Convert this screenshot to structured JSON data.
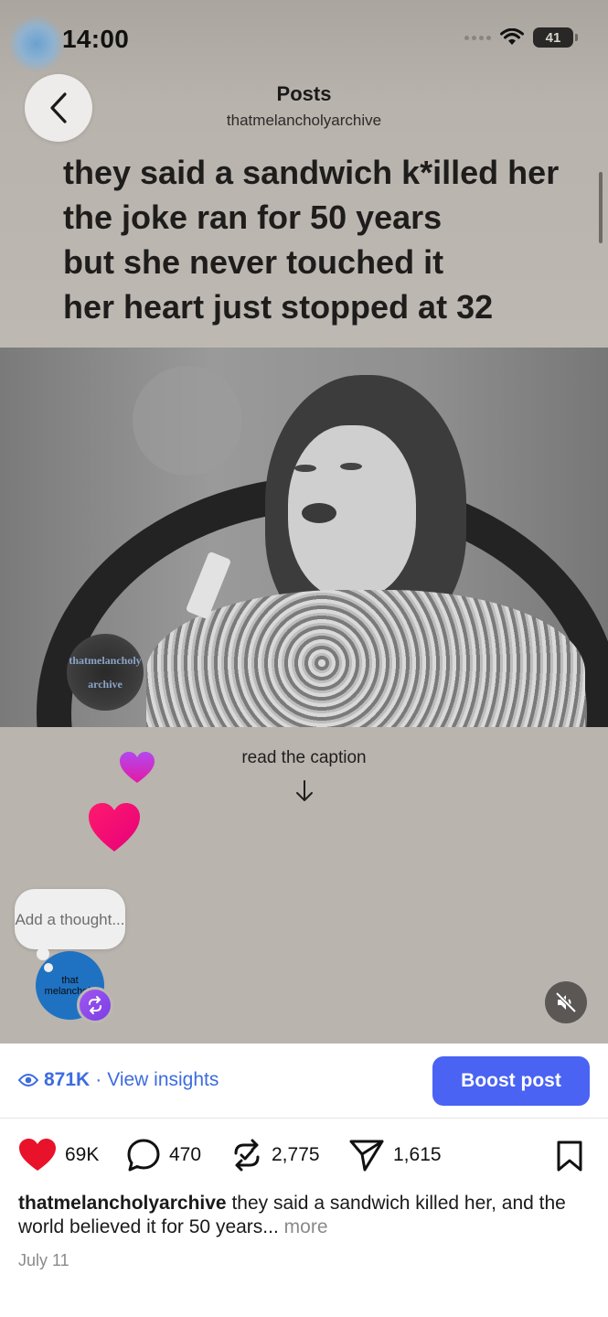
{
  "status_bar": {
    "time": "14:00",
    "battery": "41"
  },
  "header": {
    "title": "Posts",
    "username": "thatmelancholyarchive"
  },
  "post_overlay_lines": [
    "they said a sandwich k*illed her",
    "the joke ran for 50 years",
    "but she never touched it",
    "her heart just stopped at 32"
  ],
  "video_watermark": {
    "line1": "thatmelancholy",
    "line2": "archive"
  },
  "caption_hint": "read the caption",
  "thought_bubble": {
    "text": "Add a thought..."
  },
  "avatar_text": {
    "line1": "that",
    "line2": "melancholy"
  },
  "insights": {
    "views": "871K",
    "separator": "·",
    "link_label": "View insights"
  },
  "boost_label": "Boost post",
  "actions": {
    "likes": "69K",
    "comments": "470",
    "reposts": "2,775",
    "shares": "1,615"
  },
  "caption": {
    "username": "thatmelancholyarchive",
    "text": "they said a sandwich killed her, and the world believed it for 50 years...",
    "more": "more"
  },
  "date": "July 11",
  "colors": {
    "accent": "#4a63f3",
    "link": "#3d6be0",
    "like": "#e8122a",
    "repost_badge": "#8a4be8"
  }
}
